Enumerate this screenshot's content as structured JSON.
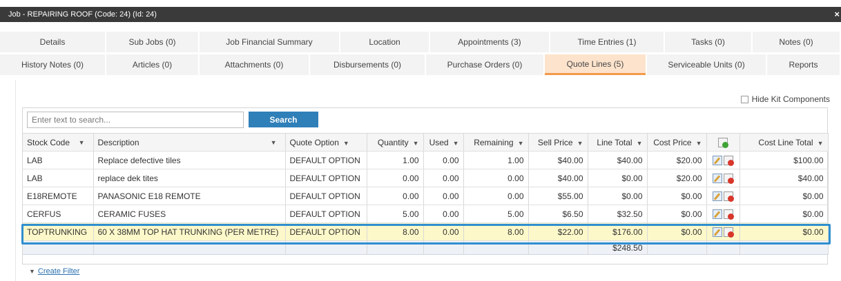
{
  "window": {
    "title": "Job - REPAIRING ROOF (Code: 24) (Id: 24)",
    "close": "×"
  },
  "tabs_row1": [
    "Details",
    "Sub Jobs (0)",
    "Job Financial Summary",
    "Location",
    "Appointments (3)",
    "Time Entries (1)",
    "Tasks (0)",
    "Notes (0)"
  ],
  "tabs_row2": [
    "History Notes (0)",
    "Articles (0)",
    "Attachments (0)",
    "Disbursements (0)",
    "Purchase Orders (0)",
    "Quote Lines (5)",
    "Serviceable Units (0)",
    "Reports"
  ],
  "active_tab": "Quote Lines (5)",
  "hide_kit": {
    "label": "Hide Kit Components",
    "checked": false
  },
  "search": {
    "placeholder": "Enter text to search...",
    "button": "Search"
  },
  "columns": [
    "Stock Code",
    "Description",
    "Quote Option",
    "Quantity",
    "Used",
    "Remaining",
    "Sell Price",
    "Line Total",
    "Cost Price",
    "Cost Line Total"
  ],
  "rows": [
    {
      "code": "LAB",
      "desc": "Replace defective tiles",
      "option": "DEFAULT OPTION",
      "qty": "1.00",
      "used": "0.00",
      "remaining": "1.00",
      "sell": "$40.00",
      "line_total": "$40.00",
      "cost": "$20.00",
      "cost_total": "$100.00"
    },
    {
      "code": "LAB",
      "desc": "replace dek tites",
      "option": "DEFAULT OPTION",
      "qty": "0.00",
      "used": "0.00",
      "remaining": "0.00",
      "sell": "$40.00",
      "line_total": "$0.00",
      "cost": "$20.00",
      "cost_total": "$40.00"
    },
    {
      "code": "E18REMOTE",
      "desc": "PANASONIC E18 REMOTE",
      "option": "DEFAULT OPTION",
      "qty": "0.00",
      "used": "0.00",
      "remaining": "0.00",
      "sell": "$55.00",
      "line_total": "$0.00",
      "cost": "$0.00",
      "cost_total": "$0.00"
    },
    {
      "code": "CERFUS",
      "desc": "CERAMIC FUSES",
      "option": "DEFAULT OPTION",
      "qty": "5.00",
      "used": "0.00",
      "remaining": "5.00",
      "sell": "$6.50",
      "line_total": "$32.50",
      "cost": "$0.00",
      "cost_total": "$0.00"
    },
    {
      "code": "TOPTRUNKING",
      "desc": "60 X 38MM TOP HAT TRUNKING (PER METRE)",
      "option": "DEFAULT OPTION",
      "qty": "8.00",
      "used": "0.00",
      "remaining": "8.00",
      "sell": "$22.00",
      "line_total": "$176.00",
      "cost": "$0.00",
      "cost_total": "$0.00"
    }
  ],
  "selected_row": 4,
  "totals": {
    "line_total": "$248.50"
  },
  "footer": {
    "create_filter": "Create Filter"
  },
  "icons": {
    "filter": "filter-icon",
    "edit": "edit-icon",
    "delete": "delete-icon",
    "add": "add-icon"
  },
  "colors": {
    "titlebar": "#3a3a3a",
    "active_tab": "#fde3cc",
    "active_tab_border": "#f29a4a",
    "search_button": "#2f7fb8",
    "selected_row": "#fcf8c9",
    "highlight_border": "#2f8fcf"
  }
}
